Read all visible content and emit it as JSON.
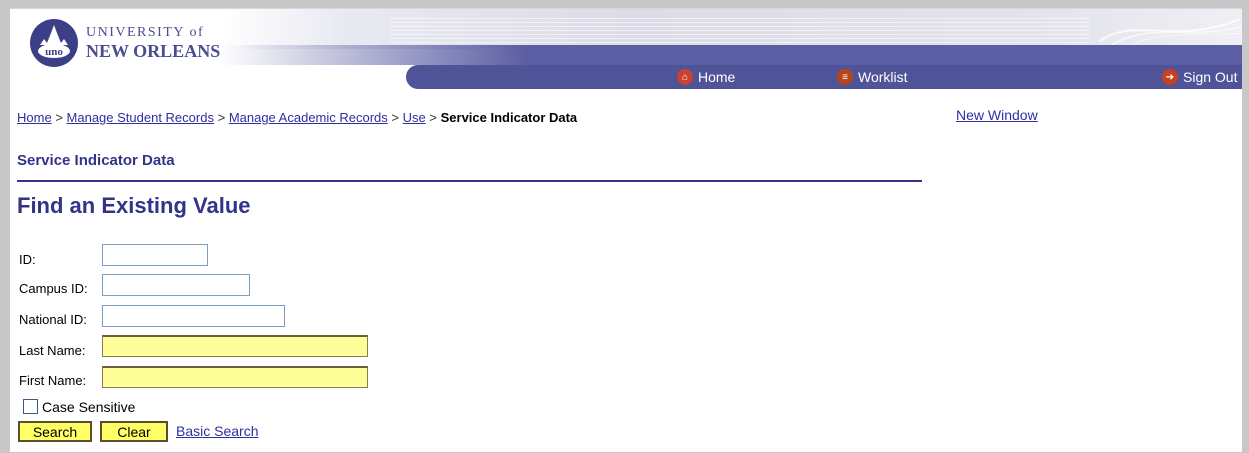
{
  "header": {
    "logo_line1": "UNIVERSITY of",
    "logo_line2": "NEW ORLEANS",
    "logo_monogram": "uno",
    "nav": [
      {
        "label": "Home",
        "icon": "home-icon"
      },
      {
        "label": "Worklist",
        "icon": "worklist-icon"
      },
      {
        "label": "Sign Out",
        "icon": "sign-out-icon"
      }
    ]
  },
  "breadcrumb": {
    "items": [
      "Home",
      "Manage Student Records",
      "Manage Academic Records",
      "Use"
    ],
    "separator": ">",
    "current": "Service Indicator Data"
  },
  "new_window": "New Window",
  "page_title": "Service Indicator Data",
  "find_title": "Find an Existing Value",
  "form": {
    "fields": [
      {
        "label": "ID:",
        "value": ""
      },
      {
        "label": "Campus ID:",
        "value": ""
      },
      {
        "label": "National ID:",
        "value": ""
      },
      {
        "label": "Last Name:",
        "value": ""
      },
      {
        "label": "First Name:",
        "value": ""
      }
    ],
    "case_sensitive_label": "Case Sensitive",
    "case_sensitive_checked": false,
    "search_label": "Search",
    "clear_label": "Clear",
    "basic_search_label": "Basic Search"
  },
  "colors": {
    "accent": "#333389",
    "nav_bar": "#4f5398",
    "required_field": "#ffff99",
    "button": "#ffff66"
  }
}
